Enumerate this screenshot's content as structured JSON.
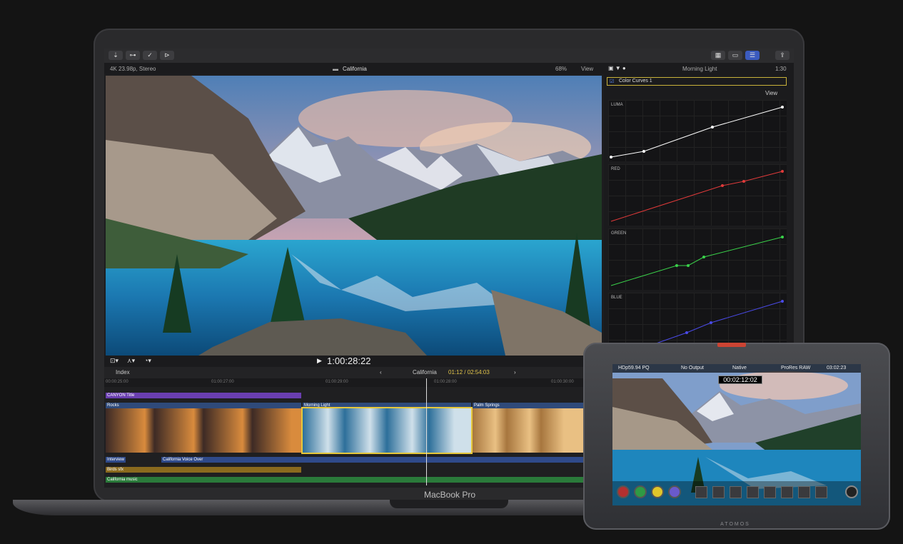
{
  "laptop": {
    "model_label": "MacBook Pro",
    "format_info": "4K 23.98p, Stereo",
    "library_name": "California",
    "zoom": "68%",
    "view_menu": "View",
    "timecode": "1:00:28:22",
    "timeline": {
      "index_label": "Index",
      "project_name": "California",
      "position": "01:12 / 02:54:03",
      "ruler_ticks": [
        "00:00:25:00",
        "01:00:27:00",
        "01:00:29:00",
        "01:00:28:00",
        "01:00:30:00"
      ],
      "clips": {
        "title_clip": "CANYON Title",
        "clip_a": "Rocks",
        "clip_b": "Morning Light",
        "clip_c": "Palm Springs",
        "audio_1": "Interview",
        "audio_2": "California Voice Over",
        "audio_3": "Birds sfx",
        "audio_4": "California music"
      }
    },
    "inspector": {
      "clip_title": "Morning Light",
      "duration": "1:30",
      "effect_name": "Color Curves 1",
      "view_label": "View",
      "curves": [
        {
          "name": "LUMA",
          "color": "#ffffff"
        },
        {
          "name": "RED",
          "color": "#e03a3a"
        },
        {
          "name": "GREEN",
          "color": "#3ad24a"
        },
        {
          "name": "BLUE",
          "color": "#4a4ae8"
        }
      ]
    }
  },
  "atomos": {
    "brand": "ATOMOS",
    "input_format": "HDp59.94 PQ",
    "output": "No Output",
    "mode": "Native",
    "codec": "ProRes RAW",
    "remaining": "03:02:23",
    "timecode": "00:02:12:02"
  }
}
